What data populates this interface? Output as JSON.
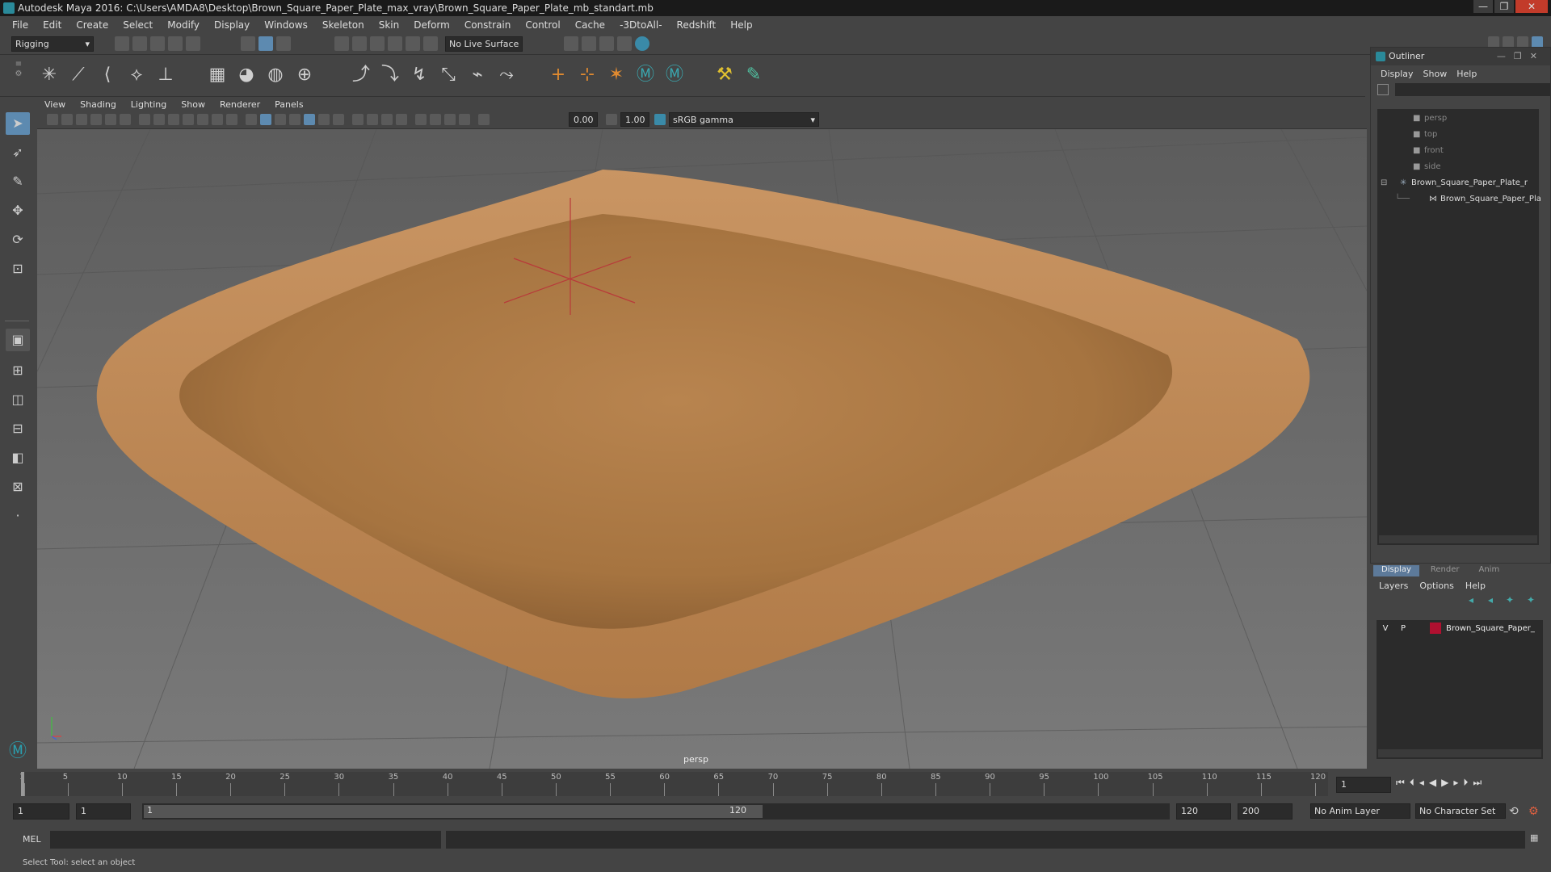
{
  "window": {
    "title": "Autodesk Maya 2016: C:\\Users\\AMDA8\\Desktop\\Brown_Square_Paper_Plate_max_vray\\Brown_Square_Paper_Plate_mb_standart.mb",
    "buttons": [
      "—",
      "❐",
      "✕"
    ]
  },
  "menubar": [
    "File",
    "Edit",
    "Create",
    "Select",
    "Modify",
    "Display",
    "Windows",
    "Skeleton",
    "Skin",
    "Deform",
    "Constrain",
    "Control",
    "Cache",
    "-3DtoAll-",
    "Redshift",
    "Help"
  ],
  "statusline": {
    "menuset": "Rigging",
    "live_surface": "No Live Surface"
  },
  "panel": {
    "menus": [
      "View",
      "Shading",
      "Lighting",
      "Show",
      "Renderer",
      "Panels"
    ],
    "exposure": "0.00",
    "gamma": "1.00",
    "color_space": "sRGB gamma",
    "camera_label": "persp"
  },
  "outliner": {
    "title": "Outliner",
    "menus": [
      "Display",
      "Show",
      "Help"
    ],
    "items": [
      {
        "label": "persp"
      },
      {
        "label": "top"
      },
      {
        "label": "front"
      },
      {
        "label": "side"
      },
      {
        "label": "Brown_Square_Paper_Plate_r"
      },
      {
        "label": "Brown_Square_Paper_Pla"
      }
    ]
  },
  "layers": {
    "tabs": [
      "Display",
      "Render",
      "Anim"
    ],
    "menus": [
      "Layers",
      "Options",
      "Help"
    ],
    "row": {
      "v": "V",
      "p": "P",
      "name": "Brown_Square_Paper_",
      "color": "#b01030"
    }
  },
  "timeline": {
    "ticks": [
      "1",
      "5",
      "10",
      "15",
      "20",
      "25",
      "30",
      "35",
      "40",
      "45",
      "50",
      "55",
      "60",
      "65",
      "70",
      "75",
      "80",
      "85",
      "90",
      "95",
      "100",
      "105",
      "110",
      "115",
      "120"
    ],
    "current_frame": "1"
  },
  "range": {
    "start": "1",
    "start2": "1",
    "slider_start": "1",
    "slider_end": "120",
    "end": "120",
    "end2": "200",
    "anim_layer": "No Anim Layer",
    "char_set": "No Character Set"
  },
  "cmdline": {
    "label": "MEL"
  },
  "helpline": "Select Tool: select an object"
}
